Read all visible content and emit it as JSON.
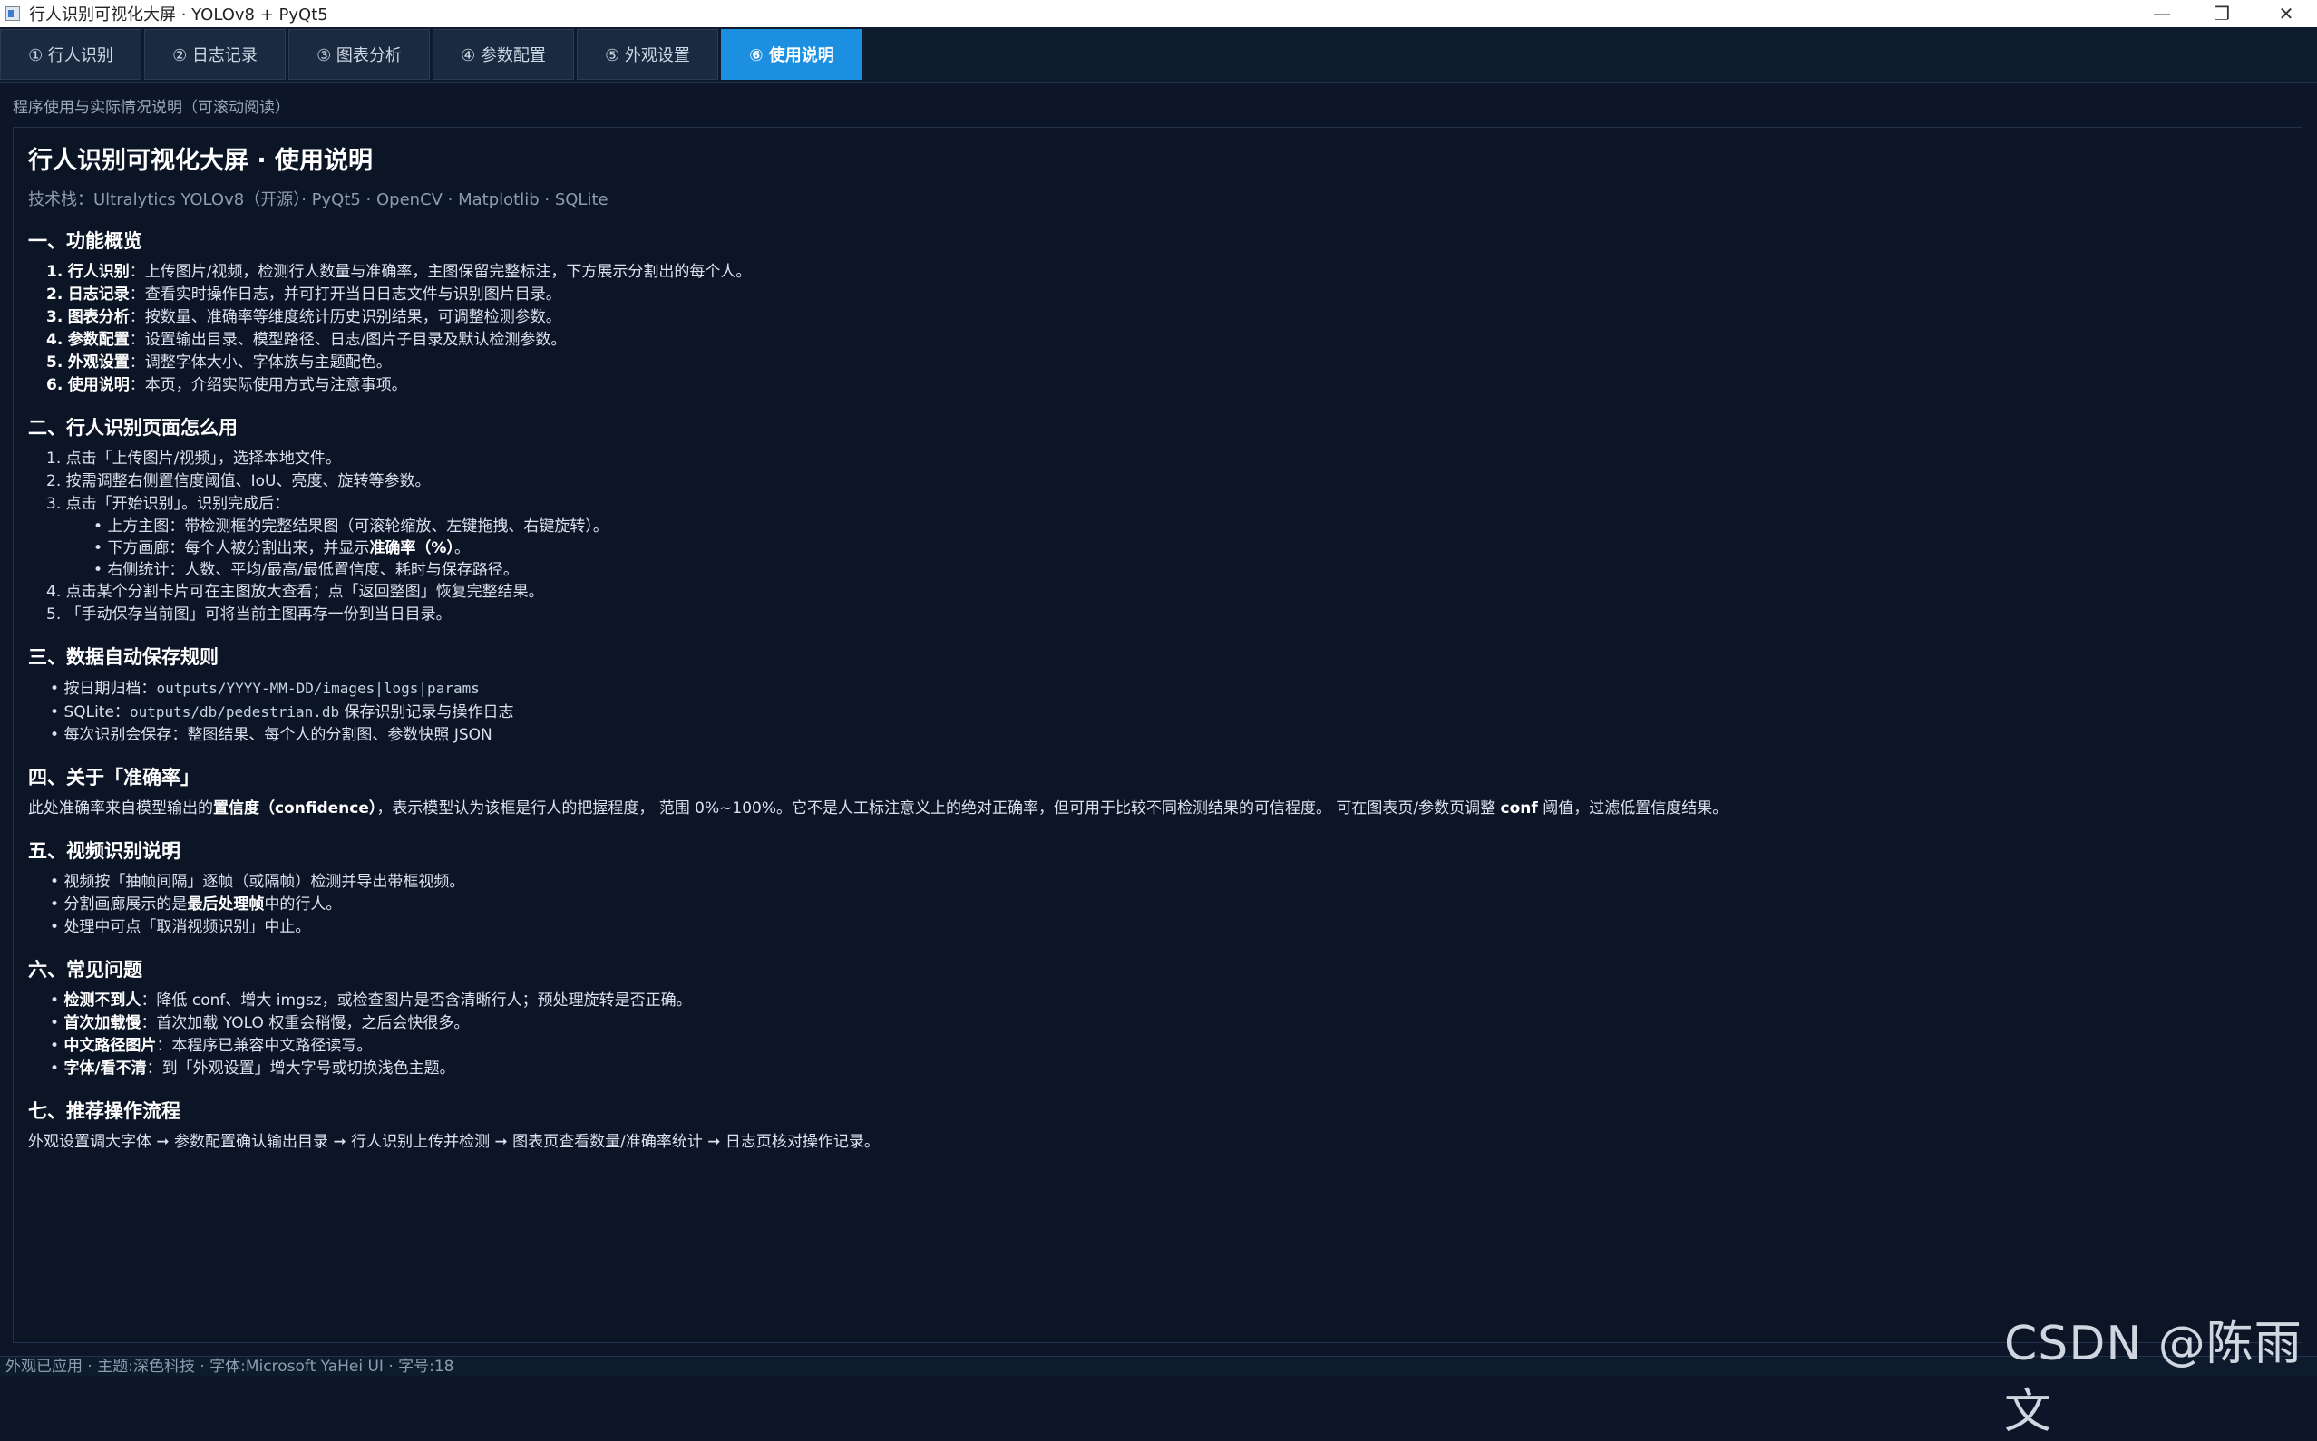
{
  "window": {
    "title": "行人识别可视化大屏 · YOLOv8 + PyQt5",
    "min": "—",
    "max": "❐",
    "close": "✕"
  },
  "tabs": [
    {
      "label": "① 行人识别"
    },
    {
      "label": "② 日志记录"
    },
    {
      "label": "③ 图表分析"
    },
    {
      "label": "④ 参数配置"
    },
    {
      "label": "⑤ 外观设置"
    },
    {
      "label": "⑥ 使用说明"
    }
  ],
  "caption": "程序使用与实际情况说明（可滚动阅读）",
  "doc": {
    "title": "行人识别可视化大屏 · 使用说明",
    "subtitle": "技术栈：Ultralytics YOLOv8（开源）· PyQt5 · OpenCV · Matplotlib · SQLite",
    "s1": {
      "heading": "一、功能概览",
      "items": [
        {
          "num": "1.",
          "bold": "行人识别",
          "text": "：上传图片/视频，检测行人数量与准确率，主图保留完整标注，下方展示分割出的每个人。"
        },
        {
          "num": "2.",
          "bold": "日志记录",
          "text": "：查看实时操作日志，并可打开当日日志文件与识别图片目录。"
        },
        {
          "num": "3.",
          "bold": "图表分析",
          "text": "：按数量、准确率等维度统计历史识别结果，可调整检测参数。"
        },
        {
          "num": "4.",
          "bold": "参数配置",
          "text": "：设置输出目录、模型路径、日志/图片子目录及默认检测参数。"
        },
        {
          "num": "5.",
          "bold": "外观设置",
          "text": "：调整字体大小、字体族与主题配色。"
        },
        {
          "num": "6.",
          "bold": "使用说明",
          "text": "：本页，介绍实际使用方式与注意事项。"
        }
      ]
    },
    "s2": {
      "heading": "二、行人识别页面怎么用",
      "i1": "1. 点击「上传图片/视频」，选择本地文件。",
      "i2": "2. 按需调整右侧置信度阈值、IoU、亮度、旋转等参数。",
      "i3": "3. 点击「开始识别」。识别完成后：",
      "sub1": "上方主图：带检测框的完整结果图（可滚轮缩放、左键拖拽、右键旋转）。",
      "sub2a": "下方画廊：每个人被分割出来，并显示",
      "sub2b": "准确率（%）",
      "sub2c": "。",
      "sub3": "右侧统计：人数、平均/最高/最低置信度、耗时与保存路径。",
      "i4": "4. 点击某个分割卡片可在主图放大查看；点「返回整图」恢复完整结果。",
      "i5": "5. 「手动保存当前图」可将当前主图再存一份到当日目录。"
    },
    "s3": {
      "heading": "三、数据自动保存规则",
      "a1": "按日期归档：",
      "a2": "outputs/YYYY-MM-DD/images|logs|params",
      "b1": "SQLite：",
      "b2": "outputs/db/pedestrian.db",
      "b3": " 保存识别记录与操作日志",
      "c1": "每次识别会保存：整图结果、每个人的分割图、参数快照 JSON"
    },
    "s4": {
      "heading": "四、关于「准确率」",
      "p1": "此处准确率来自模型输出的",
      "p2": "置信度（confidence）",
      "p3": "，表示模型认为该框是行人的把握程度，  范围 0%~100%。它不是人工标注意义上的绝对正确率，但可用于比较不同检测结果的可信程度。  可在图表页/参数页调整 ",
      "p4": "conf",
      "p5": " 阈值，过滤低置信度结果。"
    },
    "s5": {
      "heading": "五、视频识别说明",
      "a": "视频按「抽帧间隔」逐帧（或隔帧）检测并导出带框视频。",
      "b1": "分割画廊展示的是",
      "b2": "最后处理帧",
      "b3": "中的行人。",
      "c": "处理中可点「取消视频识别」中止。"
    },
    "s6": {
      "heading": "六、常见问题",
      "items": [
        {
          "bold": "检测不到人",
          "text": "：降低 conf、增大 imgsz，或检查图片是否含清晰行人；预处理旋转是否正确。"
        },
        {
          "bold": "首次加载慢",
          "text": "：首次加载 YOLO 权重会稍慢，之后会快很多。"
        },
        {
          "bold": "中文路径图片",
          "text": "：本程序已兼容中文路径读写。"
        },
        {
          "bold": "字体/看不清",
          "text": "：到「外观设置」增大字号或切换浅色主题。"
        }
      ]
    },
    "s7": {
      "heading": "七、推荐操作流程",
      "text": "外观设置调大字体 ➞ 参数配置确认输出目录 ➞ 行人识别上传并检测 ➞ 图表页查看数量/准确率统计 ➞ 日志页核对操作记录。"
    }
  },
  "status": "外观已应用 · 主题:深色科技 · 字体:Microsoft YaHei UI · 字号:18",
  "watermark": "CSDN @陈雨文"
}
